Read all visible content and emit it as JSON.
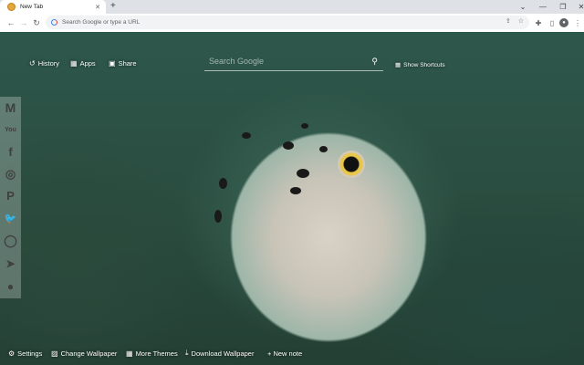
{
  "browser": {
    "tab_title": "New Tab",
    "new_tab_symbol": "+",
    "close_symbol": "✕",
    "omnibox_placeholder": "Search Google or type a URL",
    "window_controls": [
      "⌄",
      "—",
      "❐",
      "✕"
    ]
  },
  "ntp": {
    "history_label": "History",
    "apps_label": "Apps",
    "share_label": "Share",
    "search_placeholder": "Search Google",
    "show_shortcuts_label": "Show Shortcuts"
  },
  "social": [
    {
      "name": "gmail-icon",
      "glyph": "M"
    },
    {
      "name": "youtube-icon",
      "glyph": "You"
    },
    {
      "name": "facebook-icon",
      "glyph": "f"
    },
    {
      "name": "instagram-icon",
      "glyph": "◎"
    },
    {
      "name": "pinterest-icon",
      "glyph": "P"
    },
    {
      "name": "twitter-icon",
      "glyph": "🐦"
    },
    {
      "name": "whatsapp-icon",
      "glyph": "◯"
    },
    {
      "name": "telegram-icon",
      "glyph": "➤"
    },
    {
      "name": "reddit-icon",
      "glyph": "●"
    }
  ],
  "bottom": {
    "settings_label": "Settings",
    "change_wallpaper_label": "Change Wallpaper",
    "more_themes_label": "More Themes",
    "download_wallpaper_label": "Download Wallpaper",
    "new_note_label": "+ New note"
  }
}
